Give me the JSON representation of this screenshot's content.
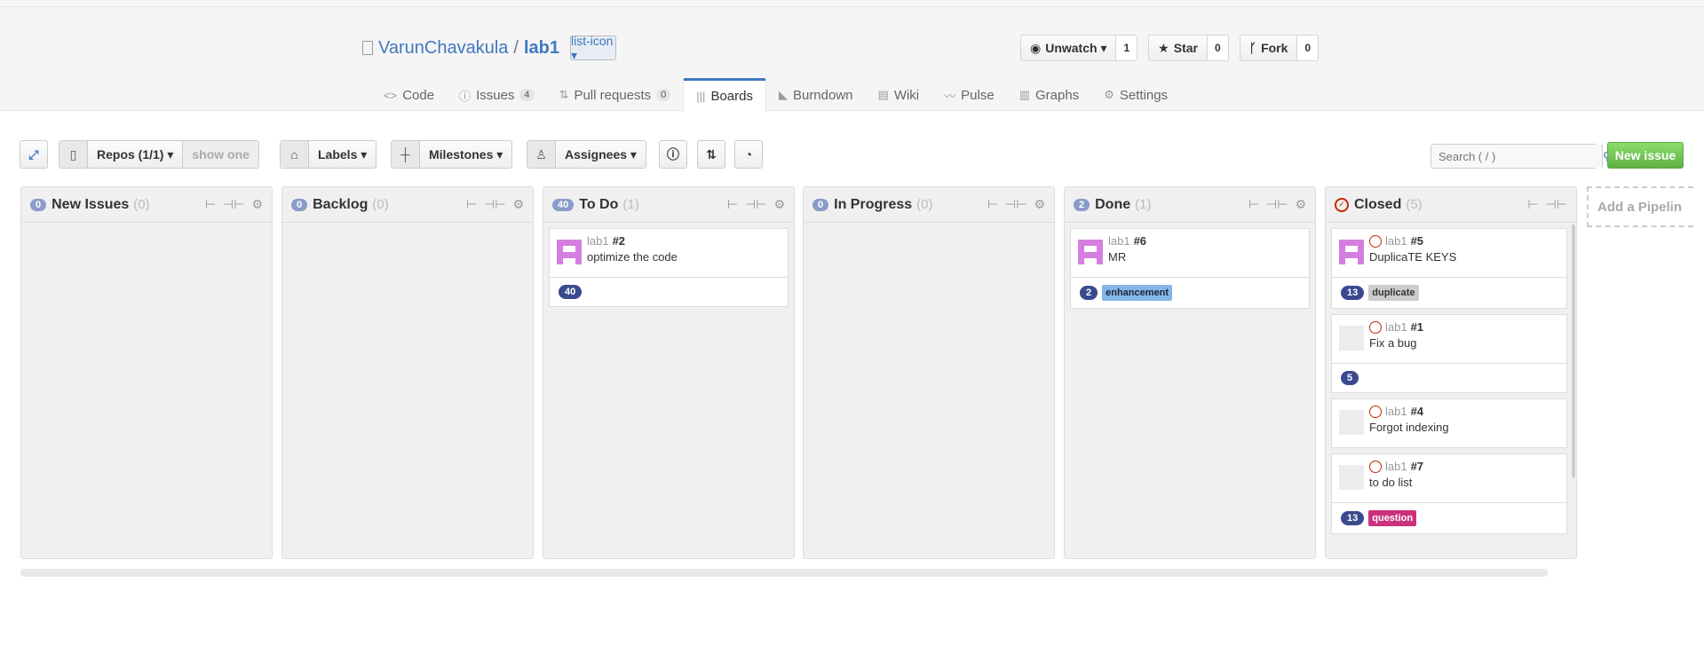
{
  "repo": {
    "owner": "VarunChavakula",
    "separator": "/",
    "name": "lab1",
    "list_icon": "list-icon ▾"
  },
  "actions": [
    {
      "label": "Unwatch ▾",
      "icon": "eye-icon",
      "count": "1"
    },
    {
      "label": "Star",
      "icon": "star-icon",
      "count": "0"
    },
    {
      "label": "Fork",
      "icon": "fork-icon",
      "count": "0"
    }
  ],
  "tabs": [
    {
      "label": "Code",
      "icon": "code-icon"
    },
    {
      "label": "Issues",
      "icon": "issue-icon",
      "badge": "4"
    },
    {
      "label": "Pull requests",
      "icon": "pull-request-icon",
      "badge": "0"
    },
    {
      "label": "Boards",
      "icon": "boards-icon",
      "active": true
    },
    {
      "label": "Burndown",
      "icon": "graph-icon"
    },
    {
      "label": "Wiki",
      "icon": "book-icon"
    },
    {
      "label": "Pulse",
      "icon": "pulse-icon"
    },
    {
      "label": "Graphs",
      "icon": "graph-icon"
    },
    {
      "label": "Settings",
      "icon": "gear-icon"
    }
  ],
  "toolbar": {
    "repos_label": "Repos (1/1) ▾",
    "show_one": "show one",
    "labels_label": "Labels ▾",
    "milestones_label": "Milestones ▾",
    "assignees_label": "Assignees ▾",
    "search_placeholder": "Search ( / )",
    "new_issue": "New issue"
  },
  "pipelines": [
    {
      "count": "0",
      "name": "New Issues",
      "num": "(0)"
    },
    {
      "count": "0",
      "name": "Backlog",
      "num": "(0)"
    },
    {
      "count": "40",
      "name": "To Do",
      "num": "(1)"
    },
    {
      "count": "0",
      "name": "In Progress",
      "num": "(0)"
    },
    {
      "count": "2",
      "name": "Done",
      "num": "(1)"
    },
    {
      "count": "",
      "name": "Closed",
      "num": "(5)"
    }
  ],
  "cards": {
    "todo": {
      "repo": "lab1",
      "number": "#2",
      "title": "optimize the code",
      "estimate": "40"
    },
    "done": {
      "repo": "lab1",
      "number": "#6",
      "title": "MR",
      "estimate": "2",
      "label": "enhancement",
      "label_color": "#84b6eb"
    },
    "closed": [
      {
        "repo": "lab1",
        "number": "#5",
        "title": "DuplicaTE KEYS",
        "estimate": "13",
        "label": "duplicate",
        "label_color": "#cccccc"
      },
      {
        "repo": "lab1",
        "number": "#1",
        "title": "Fix a bug",
        "estimate": "5"
      },
      {
        "repo": "lab1",
        "number": "#4",
        "title": "Forgot indexing"
      },
      {
        "repo": "lab1",
        "number": "#7",
        "title": "to do list",
        "estimate": "13",
        "label": "question",
        "label_color": "#cc317c"
      }
    ]
  },
  "add_pipeline": "Add a Pipelin"
}
